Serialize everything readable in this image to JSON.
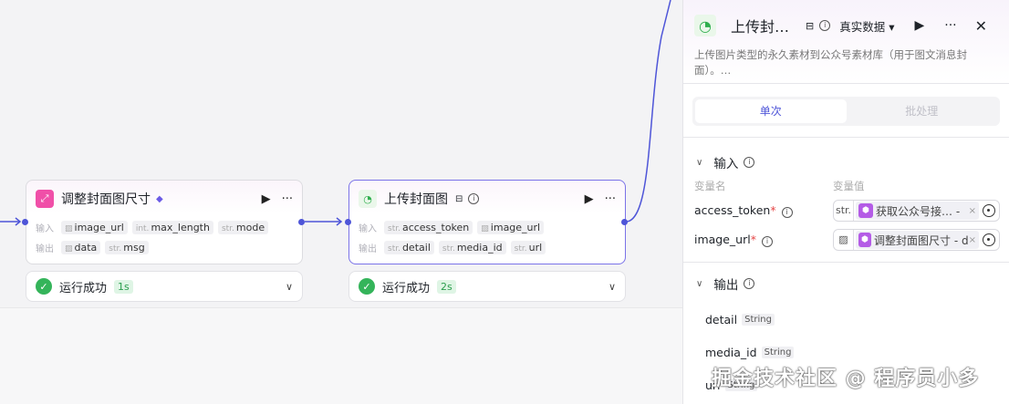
{
  "nodes": [
    {
      "title": "调整封面图尺寸",
      "in_label": "输入",
      "out_label": "输出",
      "inputs": [
        {
          "type": "img",
          "name": "image_url"
        },
        {
          "type": "int.",
          "name": "max_length"
        },
        {
          "type": "str.",
          "name": "mode"
        }
      ],
      "outputs": [
        {
          "type": "img",
          "name": "data"
        },
        {
          "type": "str.",
          "name": "msg"
        }
      ],
      "status": "运行成功",
      "duration": "1s"
    },
    {
      "title": "上传封面图",
      "in_label": "输入",
      "out_label": "输出",
      "inputs": [
        {
          "type": "str.",
          "name": "access_token"
        },
        {
          "type": "img",
          "name": "image_url"
        }
      ],
      "outputs": [
        {
          "type": "str.",
          "name": "detail"
        },
        {
          "type": "str.",
          "name": "media_id"
        },
        {
          "type": "str.",
          "name": "url"
        }
      ],
      "status": "运行成功",
      "duration": "2s"
    }
  ],
  "panel": {
    "title": "上传封…",
    "data_mode": "真实数据 ▾",
    "description": "上传图片类型的永久素材到公众号素材库（用于图文消息封面）。…",
    "tabs": [
      "单次",
      "批处理"
    ],
    "input_section": "输入",
    "col_name": "变量名",
    "col_value": "变量值",
    "inputs": [
      {
        "name": "access_token",
        "type": "str.",
        "ref": "获取公众号接…  -"
      },
      {
        "name": "image_url",
        "type": "img",
        "ref": "调整封面图尺寸 - d"
      }
    ],
    "output_section": "输出",
    "outputs": [
      {
        "name": "detail",
        "type": "String"
      },
      {
        "name": "media_id",
        "type": "String"
      },
      {
        "name": "url",
        "type": "String"
      }
    ]
  },
  "watermark": "掘金技术社区 @ 程序员小多",
  "colors": {
    "accent": "#4e55d8",
    "success": "#34b45a"
  }
}
